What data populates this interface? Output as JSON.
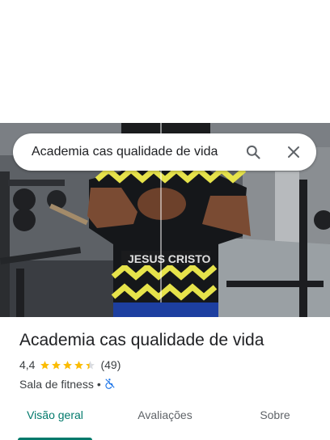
{
  "search": {
    "value": "Academia cas qualidade de vida",
    "search_icon": "search-icon",
    "close_icon": "close-icon"
  },
  "photo": {
    "description_icon": "gym-photo"
  },
  "place": {
    "name": "Academia cas qualidade de vida",
    "rating": "4,4",
    "rating_value": 4.4,
    "stars_max": 5,
    "review_count": "(49)",
    "category": "Sala de fitness",
    "separator": "•",
    "accessibility_icon": "wheelchair-not-accessible-icon"
  },
  "tabs": [
    {
      "label": "Visão geral",
      "active": true
    },
    {
      "label": "Avaliações",
      "active": false
    },
    {
      "label": "Sobre",
      "active": false
    }
  ],
  "colors": {
    "accent": "#00796b",
    "star": "#fbbc04",
    "star_empty": "#dadce0",
    "icon_blue": "#1a73e8"
  }
}
